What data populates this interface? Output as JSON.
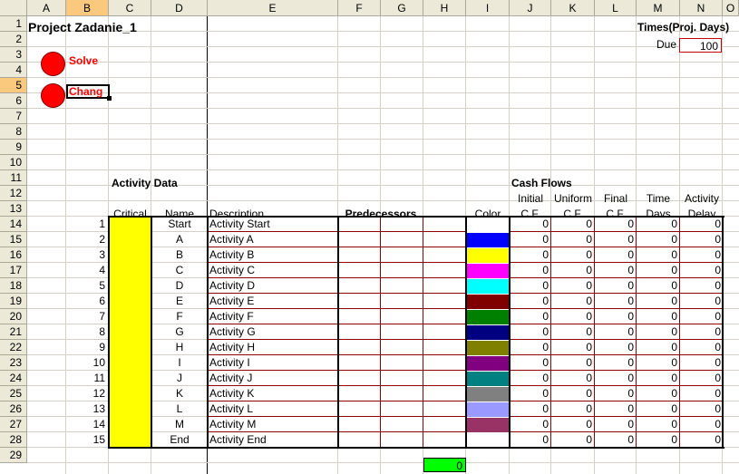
{
  "columns": [
    "A",
    "B",
    "C",
    "D",
    "E",
    "F",
    "G",
    "H",
    "I",
    "J",
    "K",
    "L",
    "M",
    "N",
    "O"
  ],
  "rows": [
    "1",
    "2",
    "3",
    "4",
    "5",
    "6",
    "7",
    "8",
    "9",
    "10",
    "11",
    "12",
    "13",
    "14",
    "15",
    "16",
    "17",
    "18",
    "19",
    "20",
    "21",
    "22",
    "23",
    "24",
    "25",
    "26",
    "27",
    "28",
    "29"
  ],
  "title": "Project Zadanie_1",
  "buttons": {
    "solve": "Solve",
    "change": "Chang"
  },
  "times_header": "Times(Proj. Days)",
  "due_label": "Due",
  "due_value": "100",
  "activity_data_label": "Activity Data",
  "cash_flows_label": "Cash Flows",
  "headers": {
    "critical": "Critical",
    "name": "Name",
    "description": "Description",
    "predecessors": "Predecessors",
    "color": "Color",
    "initial_1": "Initial",
    "initial_2": "C.F.",
    "uniform_1": "Uniform",
    "uniform_2": "C.F.",
    "final_1": "Final",
    "final_2": "C.F.",
    "time_1": "Time",
    "time_2": "Days",
    "delay_1": "Activity",
    "delay_2": "Delay"
  },
  "activities": [
    {
      "num": "1",
      "name": "Start",
      "desc": "Activity Start",
      "color": "#ffffff"
    },
    {
      "num": "2",
      "name": "A",
      "desc": "Activity A",
      "color": "#0000ff"
    },
    {
      "num": "3",
      "name": "B",
      "desc": "Activity B",
      "color": "#ffff00"
    },
    {
      "num": "4",
      "name": "C",
      "desc": "Activity C",
      "color": "#ff00ff"
    },
    {
      "num": "5",
      "name": "D",
      "desc": "Activity D",
      "color": "#00ffff"
    },
    {
      "num": "6",
      "name": "E",
      "desc": "Activity E",
      "color": "#800000"
    },
    {
      "num": "7",
      "name": "F",
      "desc": "Activity F",
      "color": "#008000"
    },
    {
      "num": "8",
      "name": "G",
      "desc": "Activity G",
      "color": "#000080"
    },
    {
      "num": "9",
      "name": "H",
      "desc": "Activity H",
      "color": "#808000"
    },
    {
      "num": "10",
      "name": "I",
      "desc": "Activity I",
      "color": "#800080"
    },
    {
      "num": "11",
      "name": "J",
      "desc": "Activity J",
      "color": "#008080"
    },
    {
      "num": "12",
      "name": "K",
      "desc": "Activity K",
      "color": "#808080"
    },
    {
      "num": "13",
      "name": "L",
      "desc": "Activity L",
      "color": "#9999ff"
    },
    {
      "num": "14",
      "name": "M",
      "desc": "Activity M",
      "color": "#993366"
    },
    {
      "num": "15",
      "name": "End",
      "desc": "Activity End",
      "color": "#ffffff"
    }
  ],
  "zero": "0",
  "total_value": "0",
  "colors": {
    "critical_fill": "#ffff00",
    "total_fill": "#00ff00",
    "button": "#ff0000"
  }
}
